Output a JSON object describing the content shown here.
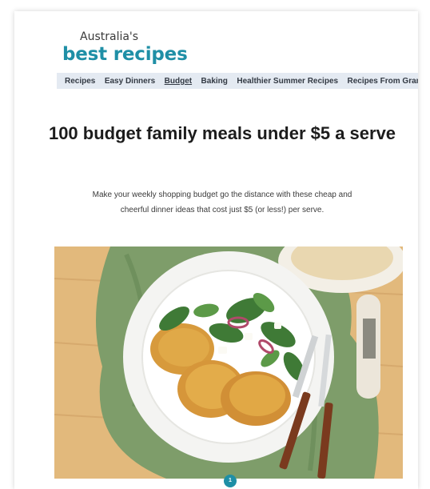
{
  "brand": {
    "top": "Australia's",
    "main": "best recipes"
  },
  "nav": {
    "items": [
      "Recipes",
      "Easy Dinners",
      "Budget",
      "Baking",
      "Healthier Summer Recipes",
      "Recipes From Gran"
    ],
    "active_index": 2
  },
  "article": {
    "title": "100 budget family meals under $5 a serve",
    "description": "Make your weekly shopping budget go the distance with these cheap and cheerful dinner ideas that cost just $5 (or less!) per serve."
  },
  "hero": {
    "alt_icon": "plated-fritters-salad-photo"
  },
  "carousel": {
    "page": "1"
  },
  "colors": {
    "brand": "#1f8fa6",
    "nav_bg": "#e4eaf2"
  }
}
